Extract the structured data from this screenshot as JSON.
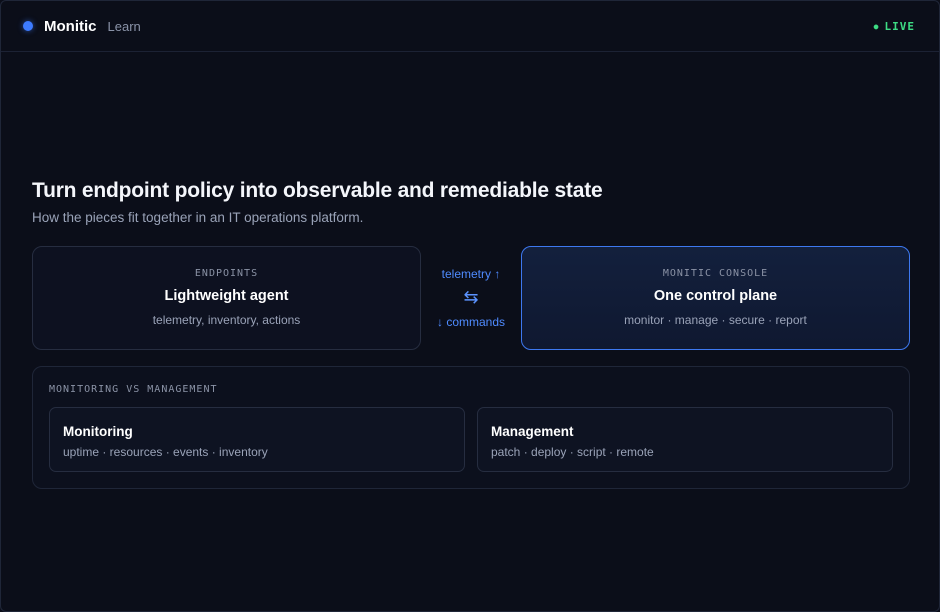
{
  "app": {
    "name": "Monitic",
    "section": "Learn",
    "status": "LIVE",
    "status_dot": "●"
  },
  "hero": {
    "title": "Turn endpoint policy into observable and remediable state",
    "subtitle": "How the pieces fit together in an IT operations platform."
  },
  "diagram": {
    "endpoints": {
      "eyebrow": "ENDPOINTS",
      "title": "Lightweight agent",
      "description": "telemetry, inventory, actions"
    },
    "connector": {
      "top_label": "telemetry ↑",
      "icon": "⇆",
      "bottom_label": "↓ commands"
    },
    "console": {
      "eyebrow": "MONITIC CONSOLE",
      "title": "One control plane",
      "description": "monitor · manage · secure · report"
    }
  },
  "comparison": {
    "heading": "MONITORING VS MANAGEMENT",
    "items": [
      {
        "title": "Monitoring",
        "description": "uptime · resources · events · inventory"
      },
      {
        "title": "Management",
        "description": "patch · deploy · script · remote"
      }
    ]
  },
  "colors": {
    "accent": "#3d7bff",
    "live": "#3ddc84",
    "background": "#0b0e19"
  },
  "icons": {
    "brand": "brand-dot-icon",
    "connector": "arrows-exchange-icon",
    "status": "status-dot-icon"
  }
}
